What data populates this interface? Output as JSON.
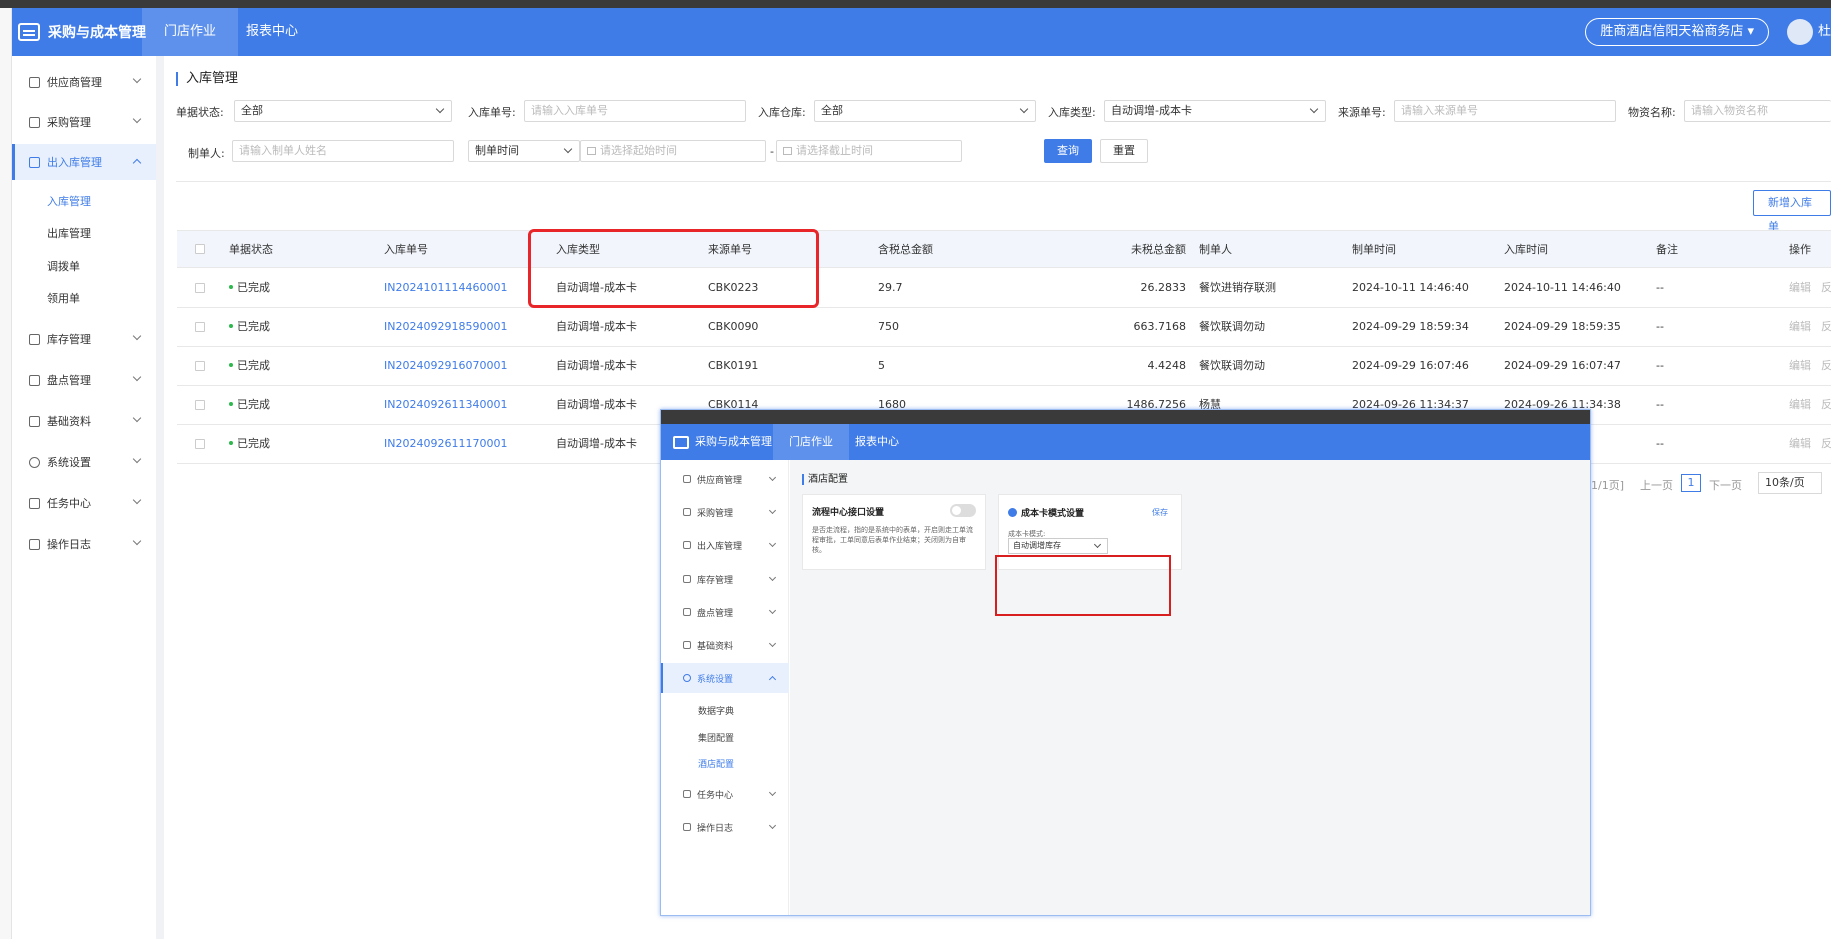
{
  "header": {
    "app_title": "采购与成本管理",
    "tabs": [
      {
        "label": "门店作业"
      },
      {
        "label": "报表中心"
      }
    ],
    "store_selector": "胜商酒店信阳天裕商务店 ▾",
    "user_name": "杜"
  },
  "sidebar": {
    "items": [
      {
        "label": "供应商管理"
      },
      {
        "label": "采购管理"
      },
      {
        "label": "出入库管理"
      },
      {
        "label": "库存管理"
      },
      {
        "label": "盘点管理"
      },
      {
        "label": "基础资料"
      },
      {
        "label": "系统设置"
      },
      {
        "label": "任务中心"
      },
      {
        "label": "操作日志"
      }
    ],
    "subitems": [
      {
        "label": "入库管理"
      },
      {
        "label": "出库管理"
      },
      {
        "label": "调拨单"
      },
      {
        "label": "领用单"
      }
    ]
  },
  "page": {
    "title": "入库管理"
  },
  "filters": {
    "doc_status": {
      "label": "单据状态:",
      "value": "全部"
    },
    "inbound_no": {
      "label": "入库单号:",
      "placeholder": "请输入入库单号"
    },
    "warehouse": {
      "label": "入库仓库:",
      "value": "全部"
    },
    "inbound_type": {
      "label": "入库类型:",
      "value": "自动调增-成本卡"
    },
    "source_no": {
      "label": "来源单号:",
      "placeholder": "请输入来源单号"
    },
    "material": {
      "label": "物资名称:",
      "placeholder": "请输入物资名称"
    },
    "creator": {
      "label": "制单人:",
      "placeholder": "请输入制单人姓名"
    },
    "time_type": {
      "value": "制单时间"
    },
    "start_time": {
      "placeholder": "请选择起始时间"
    },
    "range_sep": "-",
    "end_time": {
      "placeholder": "请选择截止时间"
    },
    "query_label": "查询",
    "reset_label": "重置"
  },
  "actions": {
    "new_inbound": "新增入库单"
  },
  "table": {
    "columns": [
      "单据状态",
      "入库单号",
      "入库类型",
      "来源单号",
      "含税总金额",
      "未税总金额",
      "制单人",
      "制单时间",
      "入库时间",
      "备注",
      "操作"
    ],
    "rows": [
      {
        "status": "已完成",
        "no": "IN2024101114460001",
        "type": "自动调增-成本卡",
        "source": "CBK0223",
        "tax_amount": "29.7",
        "net_amount": "26.2833",
        "creator": "餐饮进销存联测",
        "created": "2024-10-11 14:46:40",
        "inbound_time": "2024-10-11 14:46:40",
        "remark": "--",
        "edit": "编辑",
        "reverse": "反"
      },
      {
        "status": "已完成",
        "no": "IN2024092918590001",
        "type": "自动调增-成本卡",
        "source": "CBK0090",
        "tax_amount": "750",
        "net_amount": "663.7168",
        "creator": "餐饮联调勿动",
        "created": "2024-09-29 18:59:34",
        "inbound_time": "2024-09-29 18:59:35",
        "remark": "--",
        "edit": "编辑",
        "reverse": "反"
      },
      {
        "status": "已完成",
        "no": "IN2024092916070001",
        "type": "自动调增-成本卡",
        "source": "CBK0191",
        "tax_amount": "5",
        "net_amount": "4.4248",
        "creator": "餐饮联调勿动",
        "created": "2024-09-29 16:07:46",
        "inbound_time": "2024-09-29 16:07:47",
        "remark": "--",
        "edit": "编辑",
        "reverse": "反"
      },
      {
        "status": "已完成",
        "no": "IN2024092611340001",
        "type": "自动调增-成本卡",
        "source": "CBK0114",
        "tax_amount": "1680",
        "net_amount": "1486.7256",
        "creator": "杨慧",
        "created": "2024-09-26 11:34:37",
        "inbound_time": "2024-09-26 11:34:38",
        "remark": "--",
        "edit": "编辑",
        "reverse": "反"
      },
      {
        "status": "已完成",
        "no": "IN2024092611170001",
        "type": "自动调增-成本卡",
        "source": "",
        "tax_amount": "",
        "net_amount": "",
        "creator": "",
        "created": "",
        "inbound_time": "",
        "remark": "--",
        "edit": "编辑",
        "reverse": "反"
      }
    ]
  },
  "pagination": {
    "info": "1/1页]",
    "prev": "上一页",
    "current": "1",
    "next": "下一页",
    "page_size": "10条/页"
  },
  "overlay": {
    "app_title": "采购与成本管理",
    "tabs": [
      {
        "label": "门店作业"
      },
      {
        "label": "报表中心"
      }
    ],
    "menu": [
      {
        "label": "供应商管理"
      },
      {
        "label": "采购管理"
      },
      {
        "label": "出入库管理"
      },
      {
        "label": "库存管理"
      },
      {
        "label": "盘点管理"
      },
      {
        "label": "基础资料"
      },
      {
        "label": "系统设置"
      },
      {
        "label": "任务中心"
      },
      {
        "label": "操作日志"
      }
    ],
    "submenu": [
      {
        "label": "数据字典"
      },
      {
        "label": "集团配置"
      },
      {
        "label": "酒店配置"
      }
    ],
    "page_title": "酒店配置",
    "card1": {
      "title": "流程中心接口设置",
      "desc": "是否走流程，指的是系统中的表单，开启则走工单流程审批，工单同意后表单作业结束；关闭则为自审核。"
    },
    "card2": {
      "title": "成本卡模式设置",
      "save": "保存",
      "field_label": "成本卡模式:",
      "field_value": "自动调增库存"
    }
  },
  "colors": {
    "primary": "#3f7ce8",
    "highlight": "#e8262a",
    "success": "#2db84d"
  }
}
